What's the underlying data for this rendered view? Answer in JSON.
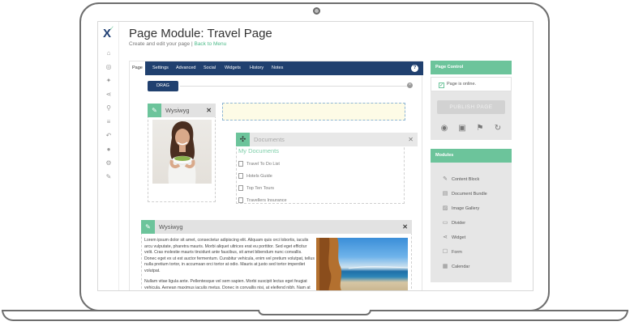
{
  "page": {
    "title": "Page Module: Travel Page",
    "subtitle": "Create and edit your page |",
    "back_link": "Back to Menu"
  },
  "sidebar": {
    "logo": "X",
    "icons": [
      "home-icon",
      "dashboard-icon",
      "puzzle-icon",
      "share-icon",
      "search-icon",
      "list-icon",
      "reply-icon",
      "user-icon",
      "settings-icon",
      "wrench-icon"
    ]
  },
  "tabs": [
    "Page",
    "Settings",
    "Advanced",
    "Social",
    "Widgets",
    "History",
    "Notes"
  ],
  "toolbar": {
    "help": "?",
    "drag_label": "DRAG"
  },
  "widgets": {
    "wysiwyg_top": {
      "label": "Wysiwyg",
      "close": "✕"
    },
    "documents": {
      "label": "Documents",
      "close": "✕",
      "title": "My Documents",
      "items": [
        "Travel To Do List",
        "Hotels Guide",
        "Top Ten Tours",
        "Travellers Insurance"
      ]
    },
    "wysiwyg_bottom": {
      "label": "Wysiwyg",
      "close": "✕",
      "para1": "Lorem ipsum dolor sit amet, consectetur adipiscing elit. Aliquam quis orci lobortis, iaculis arcu vulputate, pharetra mauris. Morbi aliquet ultrices erat eu porttitor. Sed eget efficitur velit. Cras molestie mauris tincidunt ante faucibus, sit amet bibendum nunc convallis. Donec eget ex ut est auctor fermentum. Curabitur vehicula, enim vel pretium volutpat, tellus nulla pretium tortor, in accumsan orci tortor at odio. Mauris at justo sed tortor imperdiet volutpat.",
      "para2": "Nullam vitae ligula ante. Pellentesque vel sem sapien. Morbi suscipit lectus eget feugiat vehicula. Aenean maximus iaculis metus. Donec in convallis nisi, at eleifend nibh. Nam at"
    }
  },
  "page_control": {
    "header": "Page Control",
    "status": "Page is online.",
    "publish": "PUBLISH PAGE",
    "icons": [
      "eye-icon",
      "save-icon",
      "flag-icon",
      "refresh-icon"
    ]
  },
  "modules": {
    "header": "Modules",
    "items": [
      "Content Block",
      "Document Bundle",
      "Image Gallery",
      "Divider",
      "Widget",
      "Form",
      "Calendar"
    ]
  },
  "colors": {
    "nav": "#20406f",
    "accent": "#6cc49b"
  }
}
